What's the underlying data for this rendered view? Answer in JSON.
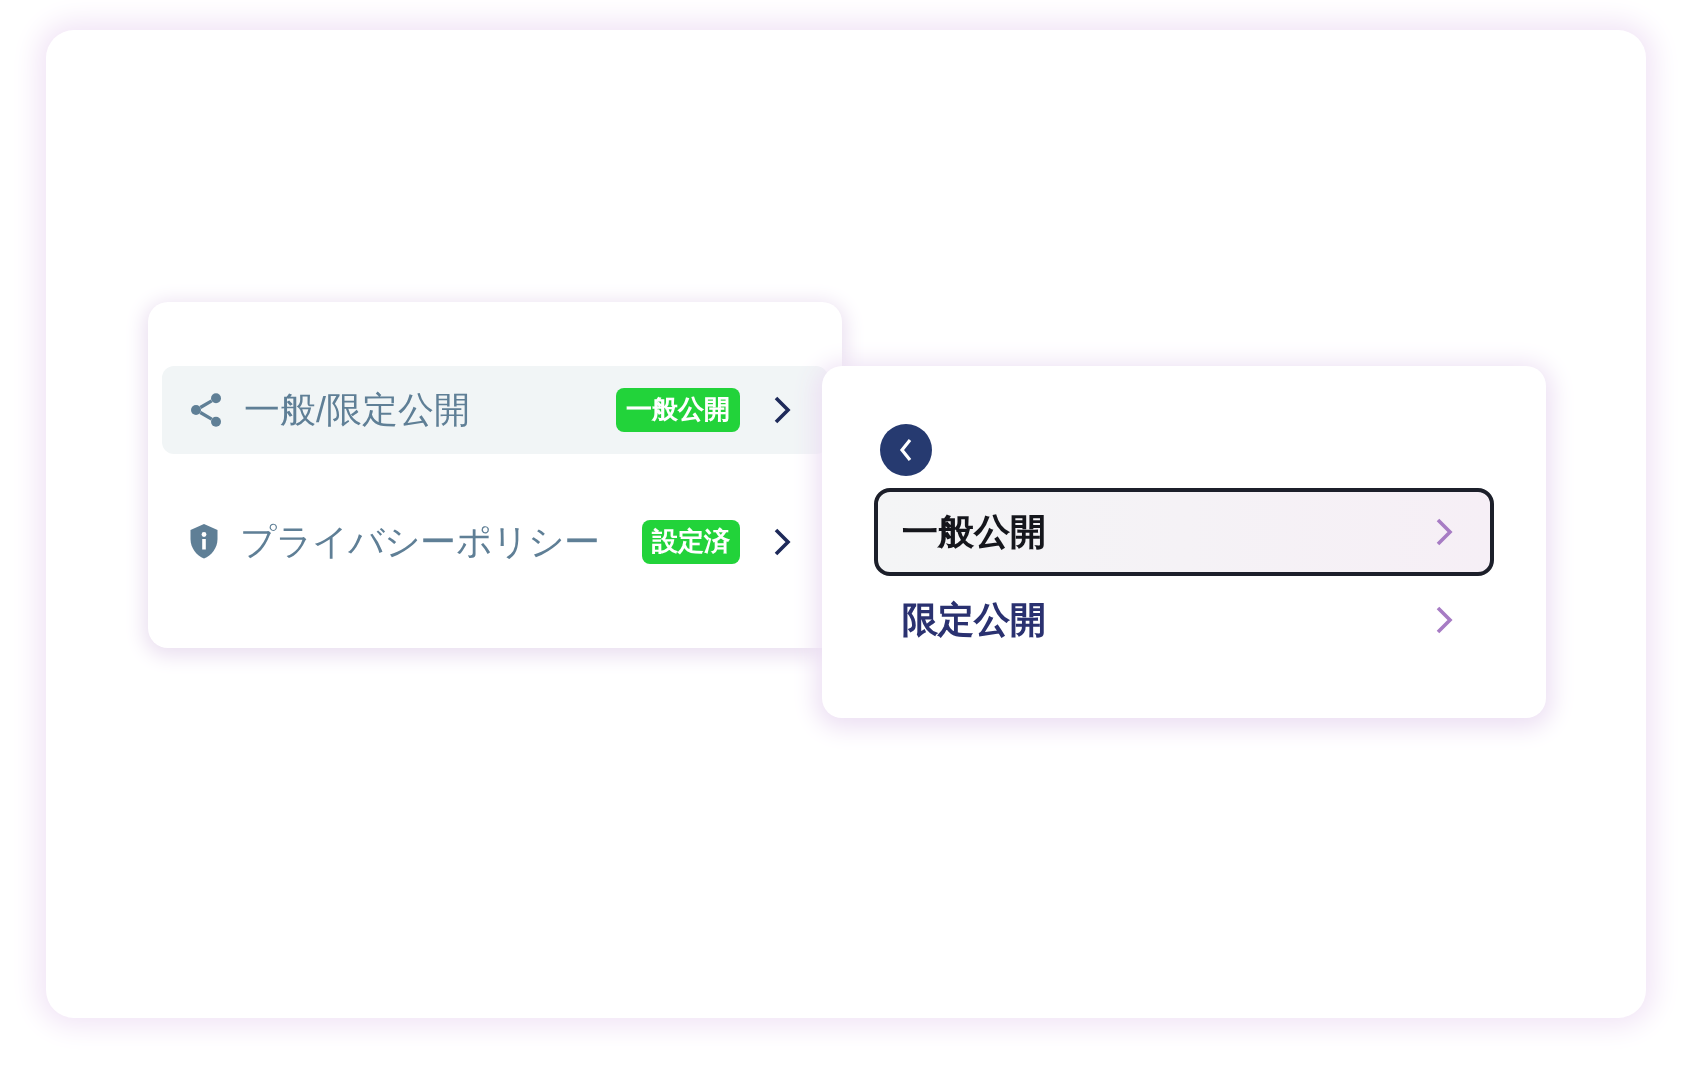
{
  "menu": {
    "items": [
      {
        "kind": "share",
        "label": "一般/限定公開",
        "badge": "一般公開",
        "selected": true
      },
      {
        "kind": "shield",
        "label": "プライバシーポリシー",
        "badge": "設定済",
        "selected": false
      }
    ]
  },
  "submenu": {
    "items": [
      {
        "label": "一般公開",
        "selected": true
      },
      {
        "label": "限定公開",
        "selected": false
      }
    ]
  }
}
